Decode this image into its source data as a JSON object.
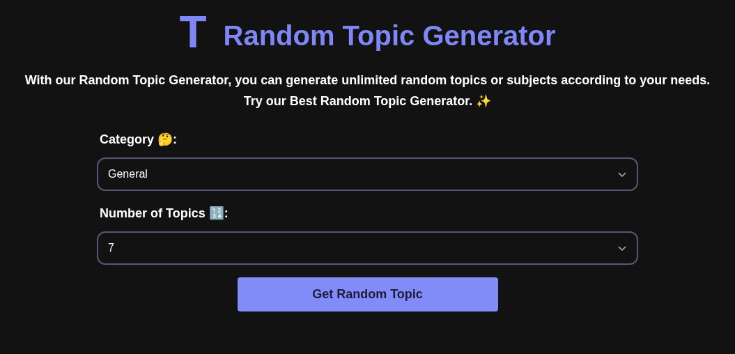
{
  "logo": {
    "letter": "T"
  },
  "title": "Random Topic Generator",
  "description": "With our Random Topic Generator, you can generate unlimited random topics or subjects according to your needs. Try our Best Random Topic Generator. ✨",
  "fields": [
    {
      "label": "Category 🤔:",
      "value": "General"
    },
    {
      "label": "Number of Topics 🔢:",
      "value": "7"
    }
  ],
  "button": "Get Random Topic"
}
